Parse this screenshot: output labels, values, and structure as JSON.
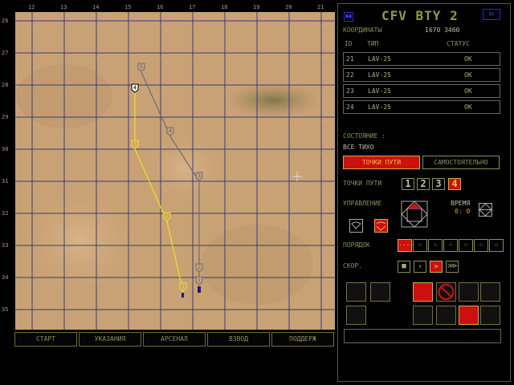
{
  "map": {
    "x_ticks": [
      "12",
      "13",
      "14",
      "15",
      "16",
      "17",
      "18",
      "19",
      "20",
      "21"
    ],
    "y_ticks": [
      "26",
      "27",
      "28",
      "29",
      "30",
      "31",
      "32",
      "33",
      "34",
      "35"
    ],
    "grey_route": [
      {
        "label": "5",
        "x": 15.4,
        "y": 27.6
      },
      {
        "label": "4",
        "x": 16.3,
        "y": 29.6
      },
      {
        "label": "3",
        "x": 17.2,
        "y": 31.0
      },
      {
        "label": "2",
        "x": 17.2,
        "y": 33.85
      },
      {
        "label": "1",
        "x": 17.2,
        "y": 34.25
      }
    ],
    "yellow_route": [
      {
        "label": "4",
        "x": 15.2,
        "y": 28.25
      },
      {
        "label": "3",
        "x": 15.2,
        "y": 30.0
      },
      {
        "label": "2",
        "x": 16.2,
        "y": 32.25
      },
      {
        "label": "1",
        "x": 16.7,
        "y": 34.45
      }
    ]
  },
  "bottom_tabs": [
    "СТАРТ",
    "УКАЗАНИЯ",
    "АРСЕНАЛ",
    "ВЗВОД",
    "ПОДДЕРЖ"
  ],
  "panel": {
    "title": "CFV BTY  2",
    "coords_label": "КООРДИНАТЫ",
    "coords_value": "1670  3460",
    "col_id": "ID",
    "col_type": "ТИП",
    "col_status": "СТАТУС",
    "units": [
      {
        "id": "21",
        "type": "LAV-25",
        "status": "OK"
      },
      {
        "id": "22",
        "type": "LAV-25",
        "status": "OK"
      },
      {
        "id": "23",
        "type": "LAV-25",
        "status": "OK"
      },
      {
        "id": "24",
        "type": "LAV-25",
        "status": "OK"
      }
    ],
    "state_label": "СОСТОЯНИЕ :",
    "state_value": "ВСЕ   ТИХО",
    "mode_waypoints": "ТОЧКИ ПУТИ",
    "mode_auto": "САМОСТОЯТЕЛЬНО",
    "waypoints_label": "ТОЧКИ ПУТИ",
    "waypoints": [
      "1",
      "2",
      "3",
      "4"
    ],
    "waypoint_selected": "4",
    "control_label": "УПРАВЛЕНИЕ",
    "time_label": "ВРЕМЯ",
    "time_value": "0: 0",
    "order_label": "ПОРЯДОК",
    "speed_label": "СКОР.",
    "status_message": ""
  }
}
